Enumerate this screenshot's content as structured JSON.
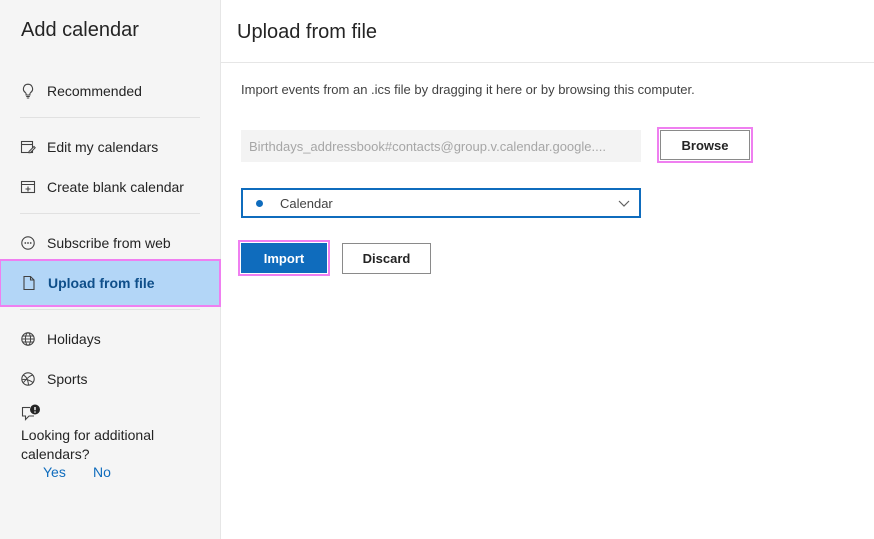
{
  "sidebar": {
    "title": "Add calendar",
    "items": [
      {
        "label": "Recommended",
        "icon": "lightbulb-icon"
      },
      {
        "label": "Edit my calendars",
        "icon": "edit-calendar-icon"
      },
      {
        "label": "Create blank calendar",
        "icon": "add-calendar-icon"
      },
      {
        "label": "Subscribe from web",
        "icon": "link-icon"
      },
      {
        "label": "Upload from file",
        "icon": "document-icon",
        "selected": true
      },
      {
        "label": "Holidays",
        "icon": "globe-icon"
      },
      {
        "label": "Sports",
        "icon": "sports-ball-icon"
      }
    ],
    "feedback": {
      "icon": "feedback-alert-icon",
      "question": "Looking for additional calendars?",
      "yes": "Yes",
      "no": "No"
    }
  },
  "main": {
    "title": "Upload from file",
    "instructions": "Import events from an .ics file by dragging it here or by browsing this computer.",
    "file_field": {
      "value": "Birthdays_addressbook#contacts@group.v.calendar.google...."
    },
    "browse_label": "Browse",
    "calendar_select": {
      "value": "Calendar"
    },
    "import_label": "Import",
    "discard_label": "Discard"
  },
  "colors": {
    "accent": "#0f6cbd",
    "selected_bg": "#b3d6f7",
    "highlight_outline": "#ef7ff0",
    "sidebar_bg": "#f5f5f5"
  }
}
